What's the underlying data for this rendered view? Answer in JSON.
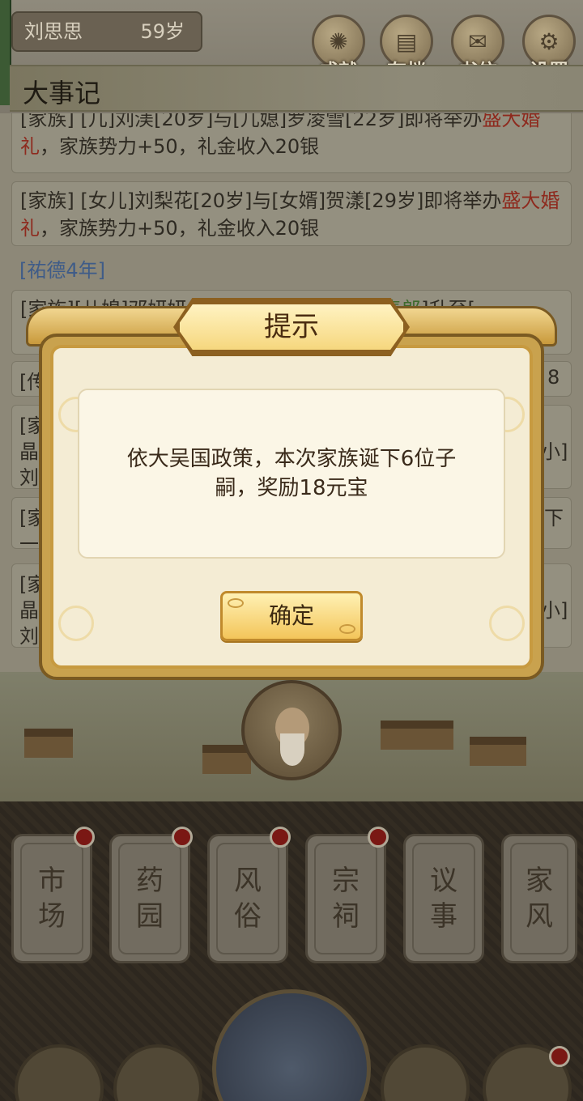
{
  "player": {
    "name": "刘思思",
    "age": "59岁"
  },
  "top_buttons": [
    {
      "label": "成就",
      "icon": "achievement-icon"
    },
    {
      "label": "存档",
      "icon": "save-icon"
    },
    {
      "label": "书信",
      "icon": "letter-icon"
    },
    {
      "label": "设置",
      "icon": "settings-icon"
    }
  ],
  "section_title": "大事记",
  "log": {
    "item1": {
      "a": "[家族] [儿]刘渼[20岁]与[儿媳]罗凌雪[22岁]即将举办",
      "b": "盛大",
      "c": "婚礼",
      "d": "，家族势力+50，礼金收入20银"
    },
    "item2": {
      "a": "[家族] [女儿]刘梨花[20岁]与[女婿]贺漾[29岁]即将举办",
      "b": "盛",
      "c": "大婚礼",
      "d": "，家族势力+50，礼金收入20银"
    },
    "year": "[祐德4年]",
    "item3": {
      "a": "[家族][儿媳]邓妍妍",
      "b": "承奉郎",
      "c": "]升至["
    },
    "frag_left": [
      "[传",
      "[家",
      "晶",
      "刘",
      "[家",
      "一",
      "[家",
      "晶",
      "刘"
    ],
    "frag_right": [
      "8",
      "小]",
      "下",
      "小]"
    ]
  },
  "dialog": {
    "title": "提示",
    "message": "依大吴国政策，本次家族诞下6位子嗣，奖励18元宝",
    "ok_label": "确定"
  },
  "categories": [
    {
      "label": "市场"
    },
    {
      "label": "药园"
    },
    {
      "label": "风俗"
    },
    {
      "label": "宗祠"
    },
    {
      "label": "议事"
    },
    {
      "label": "家风"
    }
  ],
  "colors": {
    "dialog_gold": "#c9a24e",
    "dialog_paper": "#f4ecd4",
    "ok_button": "#f3c55a",
    "highlight_red": "#8e2a1e",
    "year_blue": "#3f5c88",
    "notification_dot": "#7a1814"
  }
}
